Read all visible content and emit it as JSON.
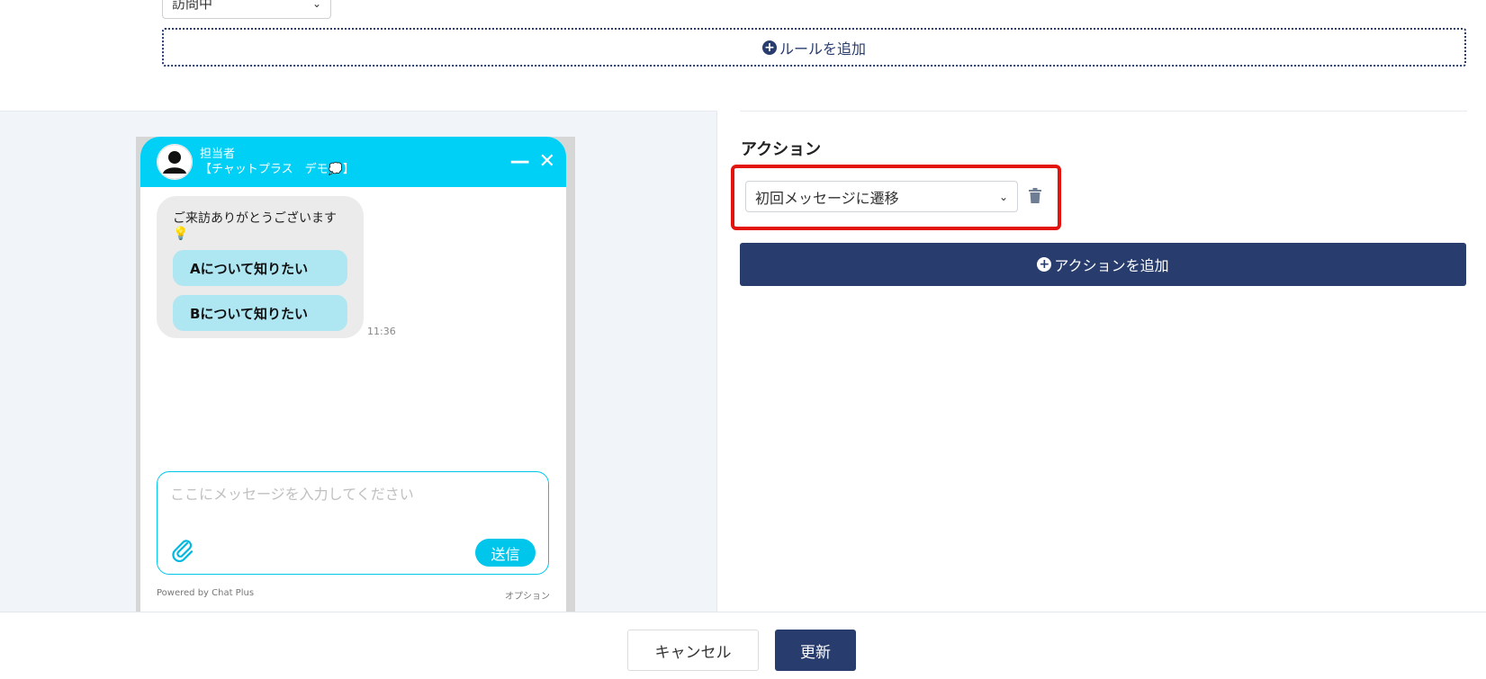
{
  "rules": {
    "status_select_value": "訪問中",
    "add_rule_label": "ルールを追加"
  },
  "chat_widget": {
    "header_title": "担当者",
    "header_subtitle": "【チャットプラス　デモ💭】",
    "minimize_glyph": "—",
    "close_glyph": "✕",
    "greeting": "ご来訪ありがとうございます💡",
    "choices": [
      "Aについて知りたい",
      "Bについて知りたい"
    ],
    "timestamp": "11:36",
    "input_placeholder": "ここにメッセージを入力してください",
    "send_label": "送信",
    "powered_by": "Powered by Chat Plus",
    "option_label": "オプション",
    "accent_color": "#00d0f5"
  },
  "actions": {
    "title": "アクション",
    "selected_action": "初回メッセージに遷移",
    "add_action_label": "アクションを追加",
    "highlight_color": "#e3140d"
  },
  "footer": {
    "cancel_label": "キャンセル",
    "update_label": "更新",
    "primary_color": "#283c6e"
  }
}
